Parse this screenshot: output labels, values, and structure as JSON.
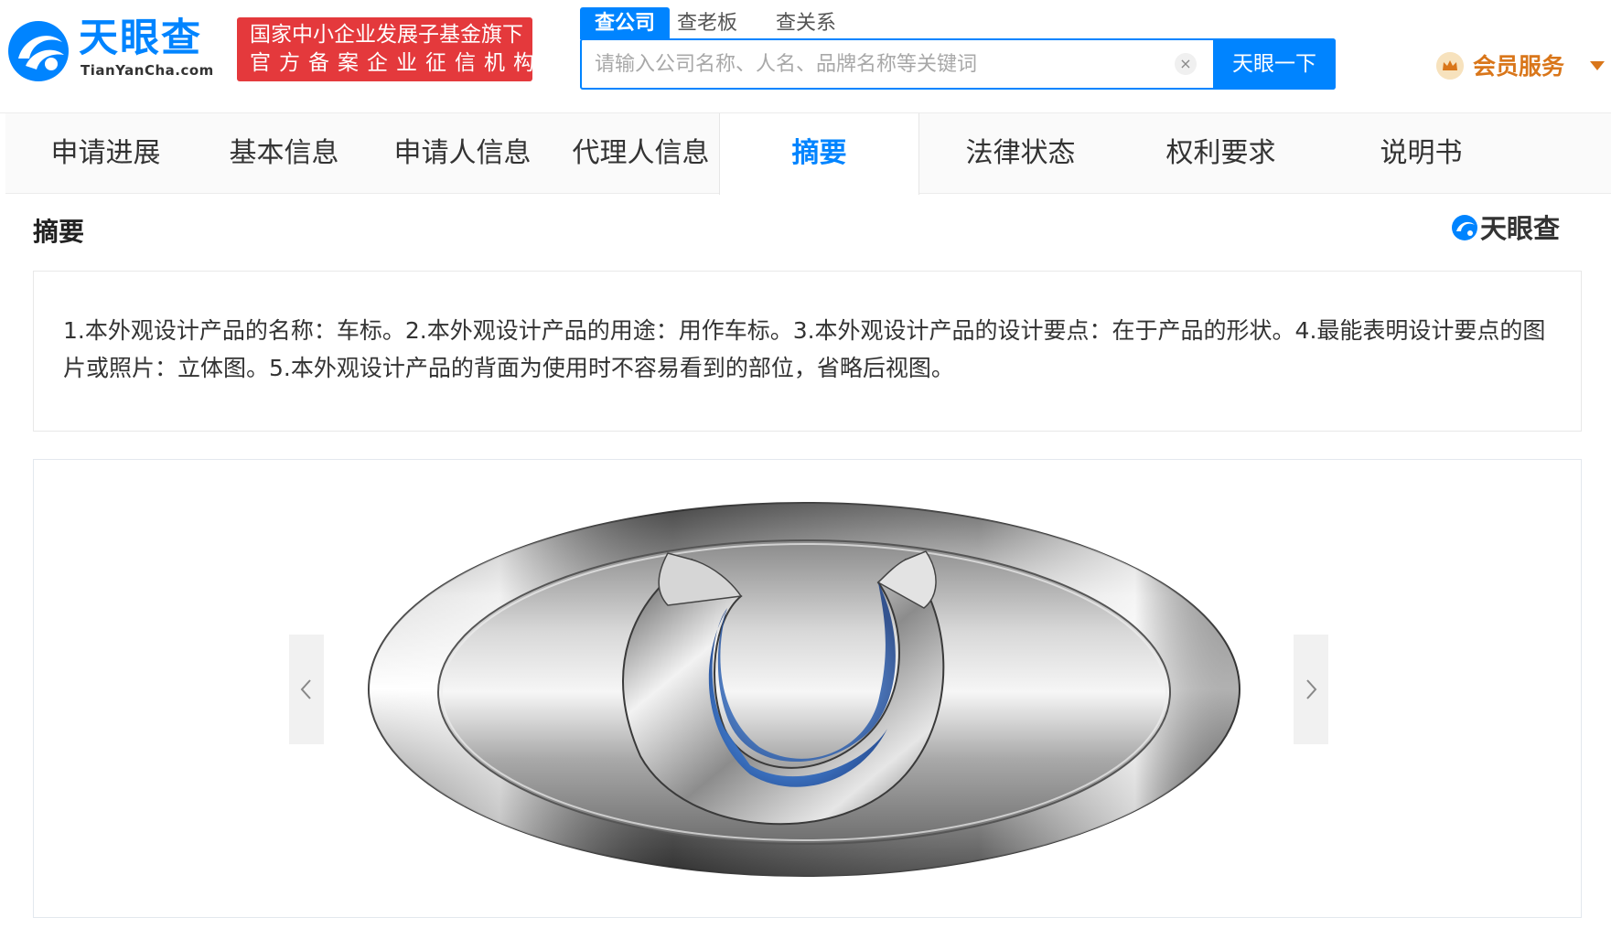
{
  "header": {
    "logo_text": "天眼查",
    "logo_domain": "TianYanCha.com",
    "banner_line1": "国家中小企业发展子基金旗下",
    "banner_line2": "官方备案企业征信机构",
    "search_tabs": [
      "查公司",
      "查老板",
      "查关系"
    ],
    "active_search_tab": "查公司",
    "search_placeholder": "请输入公司名称、人名、品牌名称等关键词",
    "clear_glyph": "×",
    "search_button": "天眼一下",
    "vip_label": "会员服务",
    "brand_color": "#0084ff",
    "banner_color": "#e4393c",
    "vip_color": "#d9761a"
  },
  "nav": {
    "tabs": [
      "申请进展",
      "基本信息",
      "申请人信息",
      "代理人信息",
      "摘要",
      "法律状态",
      "权利要求",
      "说明书"
    ],
    "active": "摘要"
  },
  "section": {
    "title": "摘要",
    "watermark": "天眼查",
    "abstract": "1.本外观设计产品的名称：车标。2.本外观设计产品的用途：用作车标。3.本外观设计产品的设计要点：在于产品的形状。4.最能表明设计要点的图片或照片：立体图。5.本外观设计产品的背面为使用时不容易看到的部位，省略后视图。"
  },
  "icons": {
    "logo": "tianyancha-eye-icon",
    "clear": "close-icon",
    "vip": "crown-icon",
    "prev": "chevron-left-icon",
    "next": "chevron-right-icon"
  }
}
